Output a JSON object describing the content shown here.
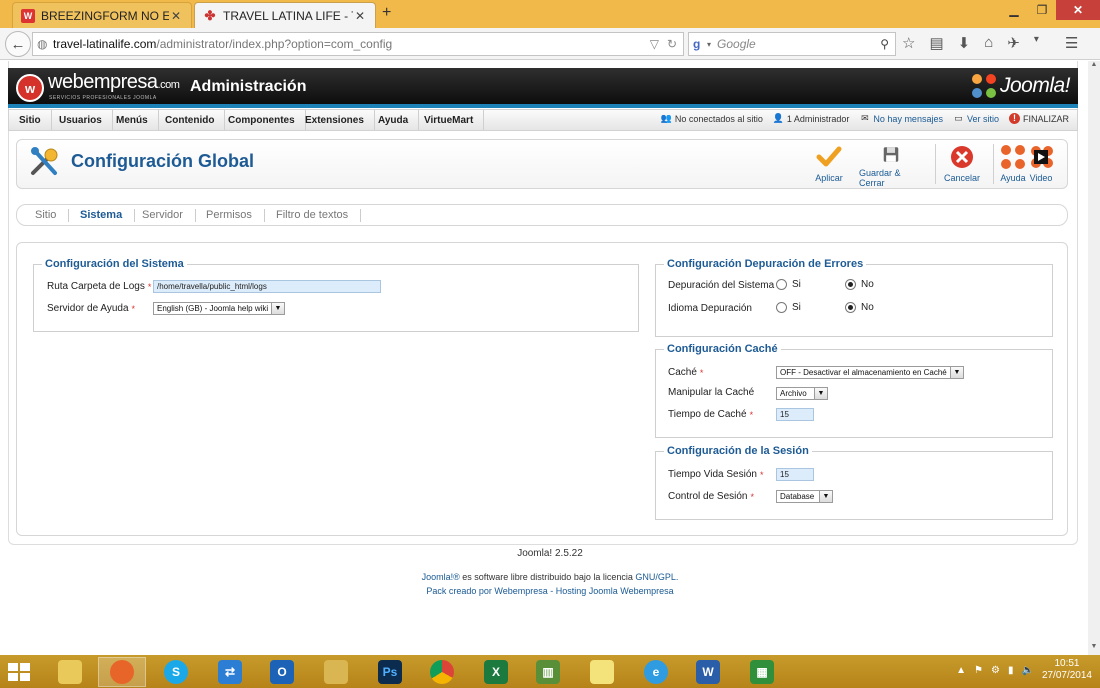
{
  "browser": {
    "tabs": [
      {
        "title": "BREEZINGFORM NO ENVIA...",
        "active": false
      },
      {
        "title": "TRAVEL LATINA LIFE - TO...",
        "active": true
      }
    ],
    "new_tab": "+",
    "url_host": "travel-latinalife.com",
    "url_path": "/administrator/index.php?option=com_config",
    "search_placeholder": "Google"
  },
  "header": {
    "brand": "webempresa",
    "brand_suffix": ".com",
    "brand_sub": "SERVICIOS PROFESIONALES JOOMLA",
    "title": "Administración",
    "joomla_logo": "Joomla!"
  },
  "menu": {
    "items": [
      "Sitio",
      "Usuarios",
      "Menús",
      "Contenido",
      "Componentes",
      "Extensiones",
      "Ayuda",
      "VirtueMart"
    ]
  },
  "status": {
    "offline": "No conectados al sitio",
    "admins": "1 Administrador",
    "messages": "No hay mensajes",
    "view_site": "Ver sitio",
    "logout": "FINALIZAR"
  },
  "toolbar": {
    "page_title": "Configuración Global",
    "apply": "Aplicar",
    "save_close": "Guardar & Cerrar",
    "cancel": "Cancelar",
    "help": "Ayuda",
    "video": "Video"
  },
  "subtabs": [
    "Sitio",
    "Sistema",
    "Servidor",
    "Permisos",
    "Filtro de textos"
  ],
  "active_subtab": "Sistema",
  "system": {
    "legend": "Configuración del Sistema",
    "log_path_label": "Ruta Carpeta de Logs",
    "log_path_value": "/home/travella/public_html/logs",
    "help_server_label": "Servidor de Ayuda",
    "help_server_value": "English (GB) - Joomla help wiki"
  },
  "debug": {
    "legend": "Configuración Depuración de Errores",
    "system_debug_label": "Depuración del Sistema",
    "lang_debug_label": "Idioma Depuración",
    "yes": "Si",
    "no": "No"
  },
  "cache": {
    "legend": "Configuración Caché",
    "cache_label": "Caché",
    "cache_value": "OFF - Desactivar el almacenamiento en Caché",
    "handler_label": "Manipular la Caché",
    "handler_value": "Archivo",
    "time_label": "Tiempo de Caché",
    "time_value": "15"
  },
  "session": {
    "legend": "Configuración de la Sesión",
    "lifetime_label": "Tiempo Vida Sesión",
    "lifetime_value": "15",
    "handler_label": "Control de Sesión",
    "handler_value": "Database"
  },
  "footer": {
    "version": "Joomla! 2.5.22",
    "license_link": "Joomla!®",
    "license_text": " es software libre distribuido bajo la licencia ",
    "license_gpl": "GNU/GPL.",
    "pack_text": "Pack creado por ",
    "pack_link1": "Webempresa",
    "pack_sep": " - ",
    "pack_link2": "Hosting Joomla Webempresa"
  },
  "taskbar": {
    "time": "10:51",
    "date": "27/07/2014"
  },
  "colors": {
    "accent_blue": "#1d82b8",
    "title_blue": "#1e5b95",
    "taskbar": "#c1921f"
  }
}
